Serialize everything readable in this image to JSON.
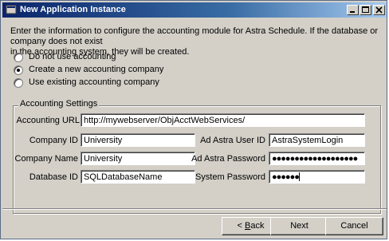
{
  "window": {
    "title": "New Application Instance",
    "controls": [
      "minimize",
      "maximize",
      "close"
    ]
  },
  "intro": {
    "line1": "Enter the information to configure the accounting module for Astra Schedule.  If the database or company does not exist",
    "line2": "in the accounting system, they will be created."
  },
  "accounting_options": [
    {
      "label": "Do not use accounting",
      "selected": false
    },
    {
      "label": "Create a new accounting company",
      "selected": true
    },
    {
      "label": "Use existing accounting company",
      "selected": false
    }
  ],
  "settings": {
    "title": "Accounting Settings",
    "accounting_url": {
      "label": "Accounting URL",
      "value": "http://mywebserver/ObjAcctWebServices/"
    },
    "company_id": {
      "label": "Company ID",
      "value": "University"
    },
    "company_name": {
      "label": "Company Name",
      "value": "University"
    },
    "database_id": {
      "label": "Database ID",
      "value": "SQLDatabaseName"
    },
    "ad_astra_user_id": {
      "label": "Ad Astra User ID",
      "value": "AstraSystemLogin"
    },
    "ad_astra_password": {
      "label": "Ad Astra Password",
      "value": "●●●●●●●●●●●●●●●●●●●"
    },
    "system_password": {
      "label": "System Password",
      "value": "●●●●●●"
    }
  },
  "buttons": {
    "back": "Back",
    "back_prefix": "< ",
    "back_mnemonic": "B",
    "back_rest": "ack",
    "next": "Next",
    "cancel": "Cancel"
  }
}
